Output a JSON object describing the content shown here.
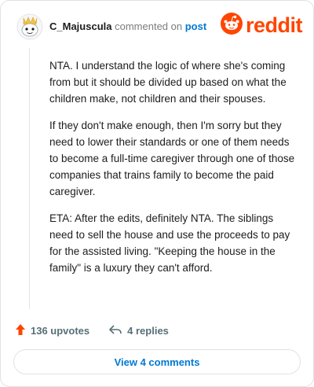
{
  "comment": {
    "author": "C_Majuscula",
    "action_text": "commented on",
    "target_link": "post",
    "paragraphs": [
      "NTA. I understand the logic of where she's coming from but it should be divided up based on what the children make, not children and their spouses.",
      "If they don't make enough, then I'm sorry but they need to lower their standards or one of them needs to become a full-time caregiver through one of those companies that trains family to become the paid caregiver.",
      "ETA: After the edits, definitely NTA. The siblings need to sell the house and use the proceeds to pay for the assisted living. \"Keeping the house in the family\" is a luxury they can't afford."
    ]
  },
  "brand": {
    "wordmark": "reddit",
    "color": "#ff4500"
  },
  "actions": {
    "upvotes": "136 upvotes",
    "replies": "4 replies"
  },
  "footer": {
    "view_comments_label": "View 4 comments"
  },
  "icons": [
    "avatar-icon",
    "reddit-snoo-icon",
    "upvote-arrow-icon",
    "reply-arrow-icon"
  ],
  "colors": {
    "accent": "#0079d3",
    "upvote": "#ff4500",
    "muted": "#576f76"
  }
}
